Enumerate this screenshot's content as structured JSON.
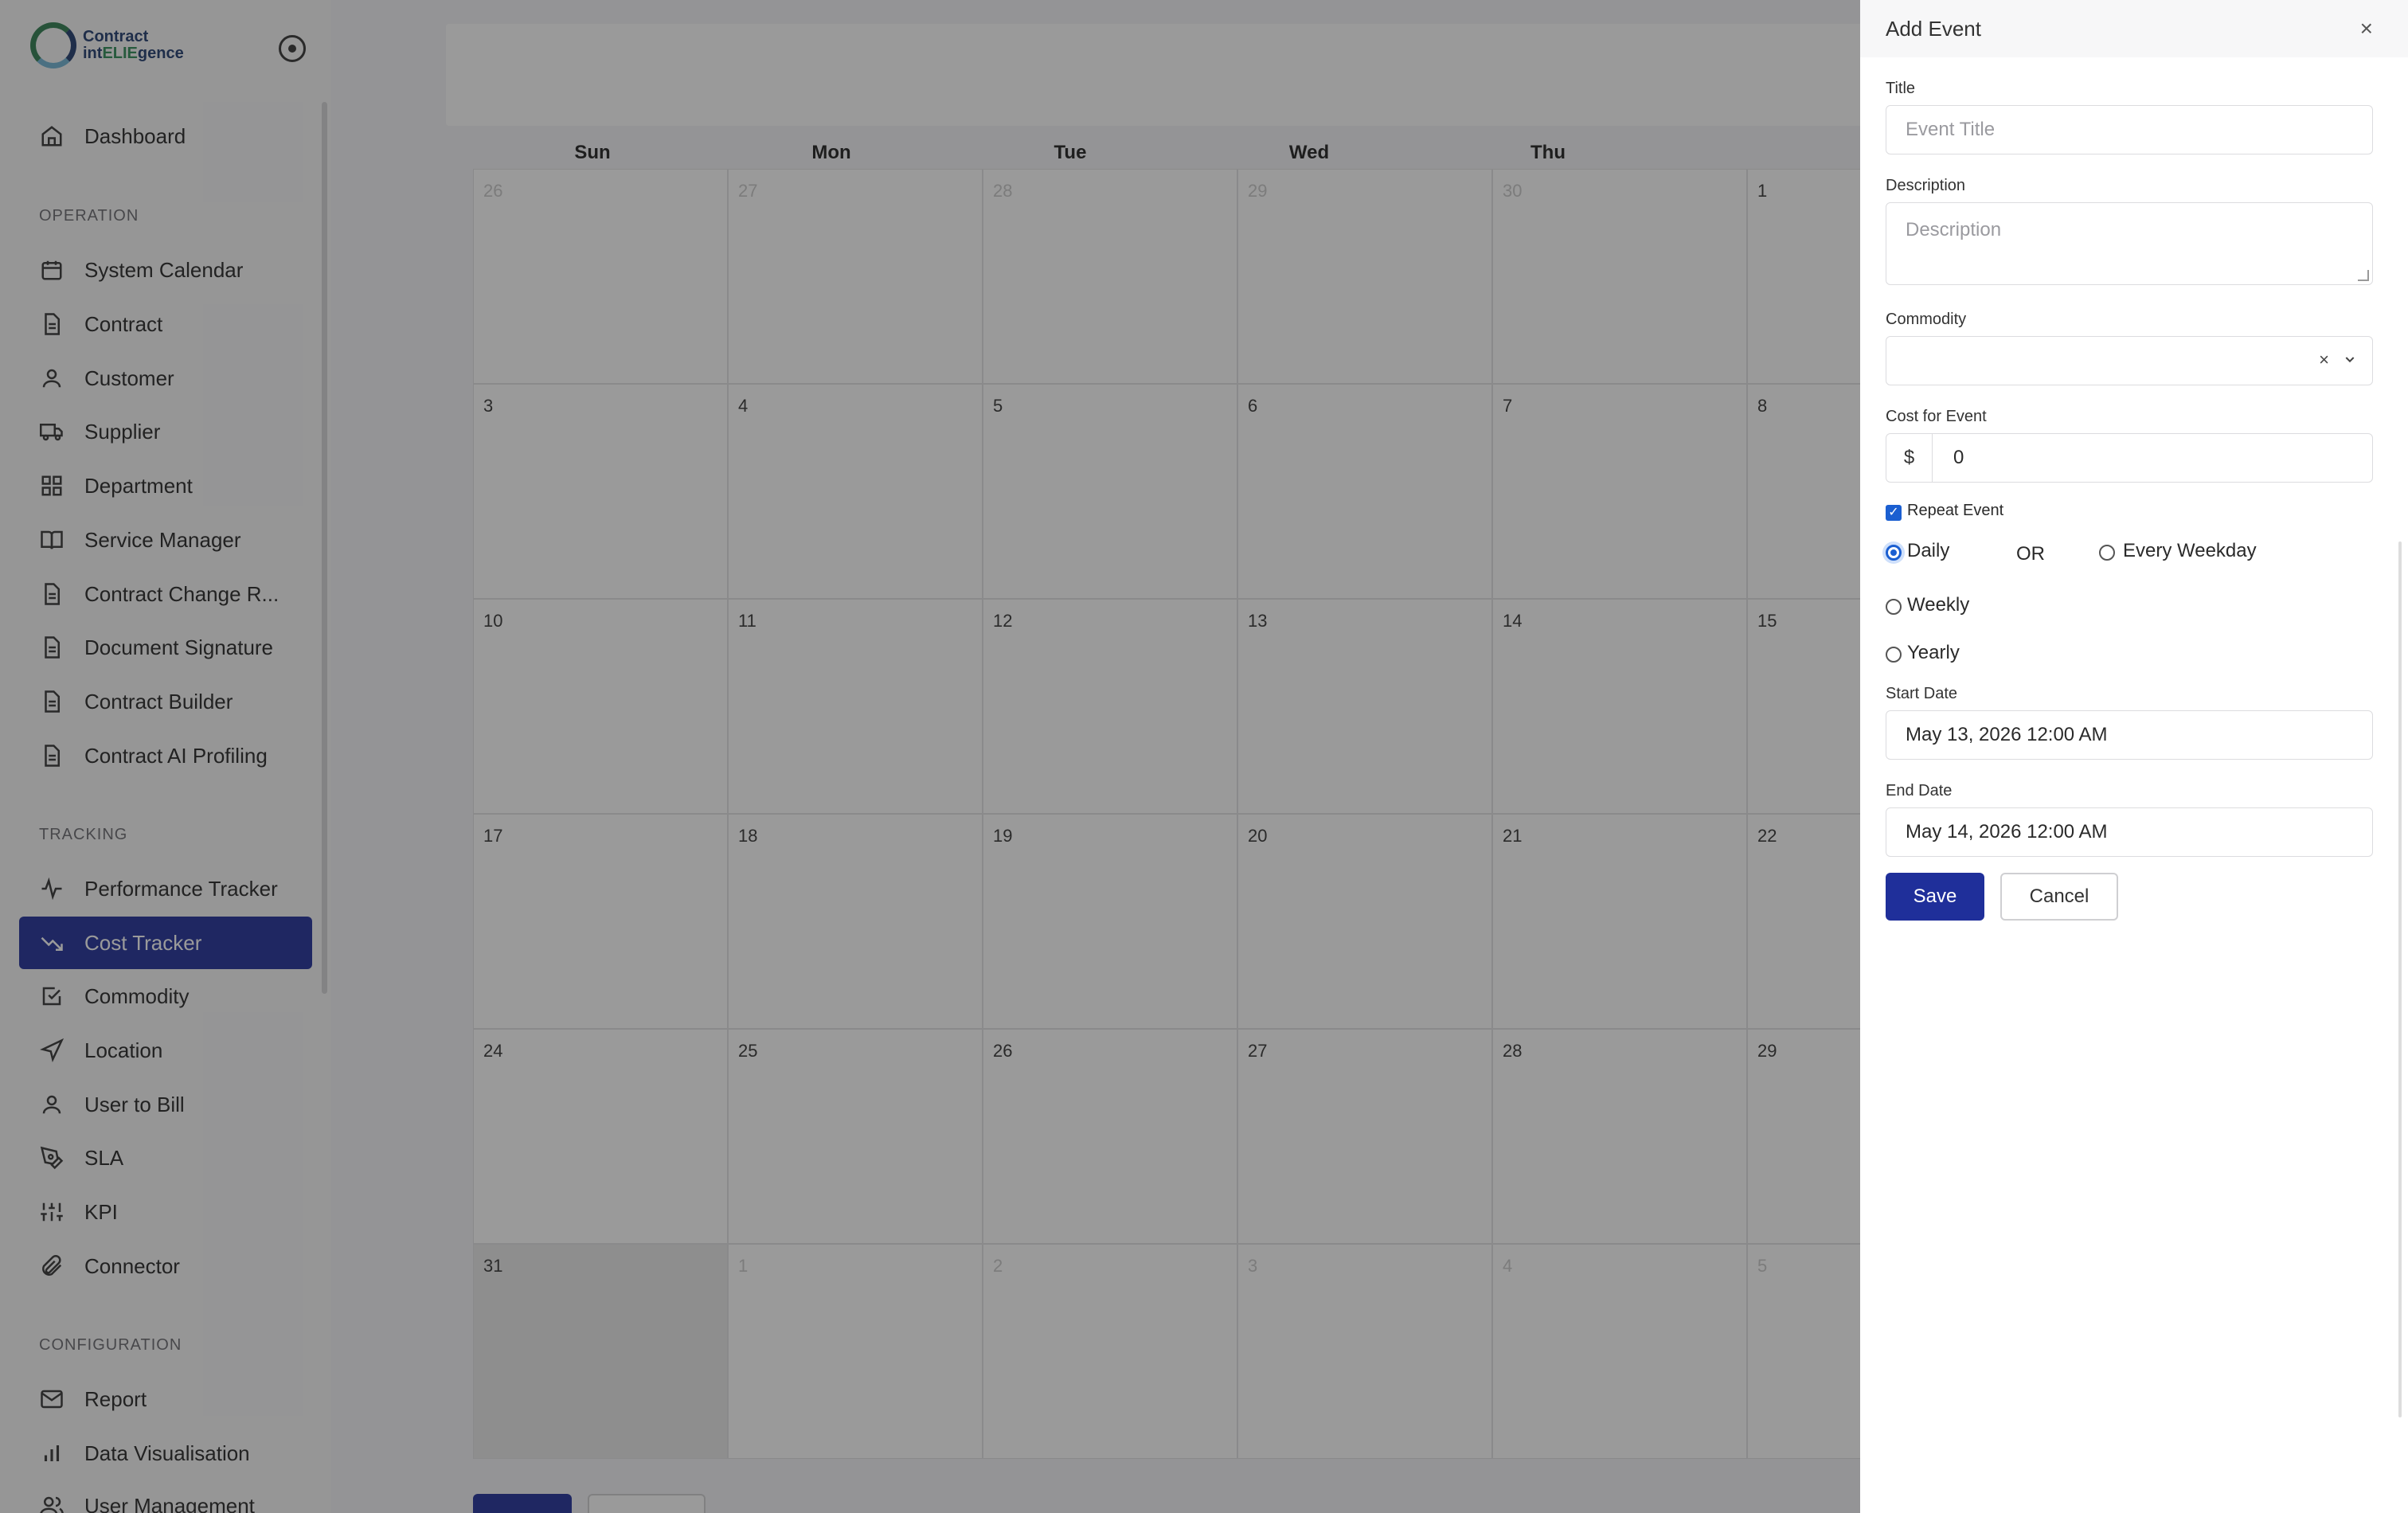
{
  "app": {
    "logo_line1": "Contract",
    "logo_line2_pre": "int",
    "logo_line2_accent": "ELIE",
    "logo_line2_post": "gence"
  },
  "sidebar": {
    "items": [
      {
        "label": "Dashboard",
        "icon": "home-icon"
      },
      {
        "section": "OPERATION"
      },
      {
        "label": "System Calendar",
        "icon": "calendar-icon"
      },
      {
        "label": "Contract",
        "icon": "document-icon"
      },
      {
        "label": "Customer",
        "icon": "user-icon"
      },
      {
        "label": "Supplier",
        "icon": "truck-icon"
      },
      {
        "label": "Department",
        "icon": "grid-icon"
      },
      {
        "label": "Service Manager",
        "icon": "book-icon"
      },
      {
        "label": "Contract Change R...",
        "icon": "document-icon"
      },
      {
        "label": "Document Signature",
        "icon": "document-icon"
      },
      {
        "label": "Contract Builder",
        "icon": "document-icon"
      },
      {
        "label": "Contract AI Profiling",
        "icon": "document-icon"
      },
      {
        "section": "TRACKING"
      },
      {
        "label": "Performance Tracker",
        "icon": "activity-icon"
      },
      {
        "label": "Cost Tracker",
        "icon": "trending-down-icon",
        "active": true
      },
      {
        "label": "Commodity",
        "icon": "check-square-icon"
      },
      {
        "label": "Location",
        "icon": "navigation-icon"
      },
      {
        "label": "User to Bill",
        "icon": "user-icon"
      },
      {
        "label": "SLA",
        "icon": "pen-tool-icon"
      },
      {
        "label": "KPI",
        "icon": "sliders-icon"
      },
      {
        "label": "Connector",
        "icon": "paperclip-icon"
      },
      {
        "section": "CONFIGURATION"
      },
      {
        "label": "Report",
        "icon": "mail-icon"
      },
      {
        "label": "Data Visualisation",
        "icon": "bar-chart-icon"
      },
      {
        "label": "User Management",
        "icon": "users-icon"
      }
    ]
  },
  "calendar": {
    "days": [
      "Sun",
      "Mon",
      "Tue",
      "Wed",
      "Thu"
    ],
    "weeks": [
      [
        "26",
        "27",
        "28",
        "29",
        "30",
        "1"
      ],
      [
        "3",
        "4",
        "5",
        "6",
        "7",
        "8"
      ],
      [
        "10",
        "11",
        "12",
        "13",
        "14",
        "15"
      ],
      [
        "17",
        "18",
        "19",
        "20",
        "21",
        "22"
      ],
      [
        "24",
        "25",
        "26",
        "27",
        "28",
        "29"
      ],
      [
        "31",
        "1",
        "2",
        "3",
        "4",
        "5"
      ]
    ]
  },
  "drawer": {
    "title": "Add Event",
    "close": "×",
    "title_label": "Title",
    "title_placeholder": "Event Title",
    "description_label": "Description",
    "description_placeholder": "Description",
    "commodity_label": "Commodity",
    "commodity_value": "",
    "cost_label": "Cost for Event",
    "currency": "$",
    "cost_value": "0",
    "repeat_label": "Repeat Event",
    "repeat_checked": true,
    "opt_daily": "Daily",
    "opt_or": "OR",
    "opt_weekday": "Every Weekday",
    "opt_weekly": "Weekly",
    "opt_yearly": "Yearly",
    "selected": "Daily",
    "start_label": "Start Date",
    "start_value": "May 13, 2026 12:00 AM",
    "end_label": "End Date",
    "end_value": "May 14, 2026 12:00 AM",
    "save": "Save",
    "cancel": "Cancel"
  },
  "colors": {
    "primary": "#1f2f9a",
    "radio": "#1b5fd1",
    "overlay": "rgba(30,30,30,0.45)"
  }
}
